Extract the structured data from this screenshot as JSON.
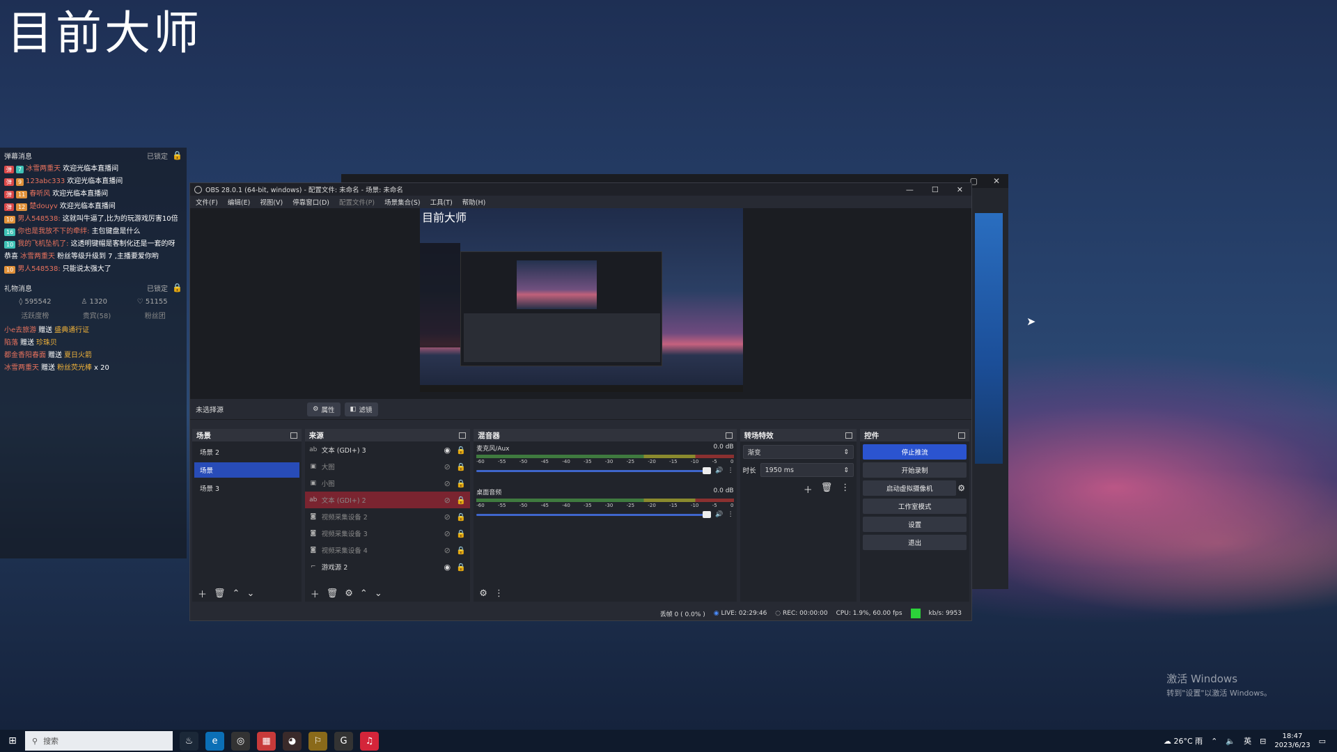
{
  "desktop": {
    "title": "目前大师",
    "watermark_line1": "激活 Windows",
    "watermark_line2": "转到\"设置\"以激活 Windows。"
  },
  "chat_overlay": {
    "danmu_header": "弹幕消息",
    "danmu_locked": "已锁定",
    "messages": [
      {
        "level": "7",
        "name": "冰雪两重天",
        "text": "欢迎光临本直播间"
      },
      {
        "level": "9",
        "name": "123abc333",
        "text": "欢迎光临本直播间"
      },
      {
        "level": "11",
        "name": "春听风",
        "text": "欢迎光临本直播间"
      },
      {
        "level": "12",
        "name": "楚douyv",
        "text": "欢迎光临本直播间"
      },
      {
        "level": "10",
        "name": "男人548538:",
        "text": "这就叫牛逼了,比为的玩游戏厉害10倍"
      },
      {
        "level": "16",
        "name": "你也是我放不下的牵绊:",
        "text": "主包键盘是什么"
      },
      {
        "level": "10",
        "name": "我的飞机坠机了:",
        "text": "这透明键帽是客制化还是一套的呀"
      },
      {
        "level": "",
        "name": "冰雪两重天",
        "text": "粉丝等级升级到 7 ,主播要爱你哟"
      },
      {
        "level": "10",
        "name": "男人548538:",
        "text": "只能说太强大了"
      }
    ],
    "congrats_prefix": "恭喜",
    "gift_header": "礼物消息",
    "gift_locked": "已锁定",
    "stats": {
      "likes": "595542",
      "viewers": "1320",
      "fans": "51155"
    },
    "gift_tabs": [
      "活跃度榜",
      "贵宾(58)",
      "粉丝团"
    ],
    "gifts": [
      {
        "name": "小e去旅游",
        "verb": "赠送",
        "item": "盛典通行证"
      },
      {
        "name": "陷落",
        "verb": "赠送",
        "item": "珍珠贝"
      },
      {
        "name": "都金香阳春面",
        "verb": "赠送",
        "item": "夏日火箭"
      },
      {
        "name": "冰雪两重天",
        "verb": "赠送",
        "item": "粉丝荧光棒",
        "count": "x 20"
      }
    ]
  },
  "obs": {
    "title": "OBS 28.0.1 (64-bit, windows) - 配置文件: 未命名 - 场景: 未命名",
    "menu": [
      "文件(F)",
      "编辑(E)",
      "视图(V)",
      "停靠窗口(D)",
      "配置文件(P)",
      "场景集合(S)",
      "工具(T)",
      "帮助(H)"
    ],
    "preview_title": "目前大师",
    "no_source": "未选择源",
    "props_btn": "属性",
    "filters_btn": "滤镜",
    "scenes_title": "场景",
    "scenes": [
      "场景 2",
      "场景",
      "场景 3"
    ],
    "sources_title": "来源",
    "sources": [
      {
        "icon": "ab",
        "name": "文本 (GDI+) 3",
        "visible": true
      },
      {
        "icon": "▣",
        "name": "大图",
        "visible": false
      },
      {
        "icon": "▣",
        "name": "小图",
        "visible": false
      },
      {
        "icon": "ab",
        "name": "文本 (GDI+) 2",
        "visible": false
      },
      {
        "icon": "◙",
        "name": "视频采集设备 2",
        "visible": false
      },
      {
        "icon": "◙",
        "name": "视频采集设备 3",
        "visible": false
      },
      {
        "icon": "◙",
        "name": "视频采集设备 4",
        "visible": false
      },
      {
        "icon": "⌐",
        "name": "游戏源 2",
        "visible": true
      }
    ],
    "mixer_title": "混音器",
    "mixer": [
      {
        "name": "麦克风/Aux",
        "db": "0.0 dB"
      },
      {
        "name": "桌面音频",
        "db": "0.0 dB"
      }
    ],
    "mixer_ticks": [
      "-60",
      "-55",
      "-50",
      "-45",
      "-40",
      "-35",
      "-30",
      "-25",
      "-20",
      "-15",
      "-10",
      "-5",
      "0"
    ],
    "transitions_title": "转场特效",
    "transition": "渐变",
    "duration_label": "时长",
    "duration": "1950 ms",
    "controls_title": "控件",
    "controls": {
      "stop_stream": "停止推流",
      "start_record": "开始录制",
      "virtual_cam": "启动虚拟摄像机",
      "studio_mode": "工作室模式",
      "settings": "设置",
      "exit": "退出"
    },
    "status": {
      "dropped": "丢帧 0 ( 0.0% )",
      "live": "LIVE: 02:29:46",
      "rec": "REC: 00:00:00",
      "cpu": "CPU: 1.9%, 60.00 fps",
      "kbps": "kb/s: 9953"
    }
  },
  "taskbar": {
    "search_placeholder": "搜索",
    "weather": "26°C 雨",
    "lang": "英",
    "time": "18:47",
    "date": "2023/6/23"
  },
  "colors": {
    "accent": "#2b54d0",
    "live_green": "#2cd33a",
    "selected_source": "#7a2430"
  }
}
